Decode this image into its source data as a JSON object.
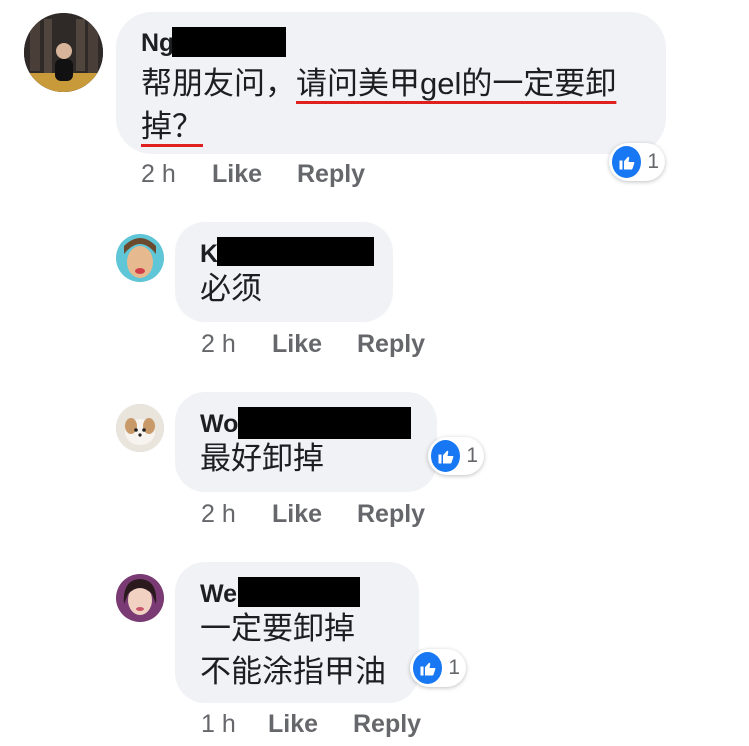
{
  "comments": [
    {
      "author": "Ng",
      "text_plain": "帮朋友问，",
      "text_underlined_1": "请问美甲gel的一定要卸",
      "text_underlined_2": "掉？",
      "time": "2 h",
      "like_label": "Like",
      "reply_label": "Reply",
      "reaction_count": "1"
    },
    {
      "author": "K",
      "text": "必须",
      "time": "2 h",
      "like_label": "Like",
      "reply_label": "Reply"
    },
    {
      "author": "Wo",
      "text": "最好卸掉",
      "time": "2 h",
      "like_label": "Like",
      "reply_label": "Reply",
      "reaction_count": "1"
    },
    {
      "author": "We",
      "text_line_1": "一定要卸掉",
      "text_line_2": "不能涂指甲油",
      "time": "1 h",
      "like_label": "Like",
      "reply_label": "Reply",
      "reaction_count": "1"
    }
  ],
  "colors": {
    "bubble": "#f0f2f5",
    "like_blue": "#1877f2",
    "underline_red": "#e0201f",
    "meta_gray": "#65676b"
  },
  "icons": {
    "reaction": "thumbs-up-icon"
  }
}
